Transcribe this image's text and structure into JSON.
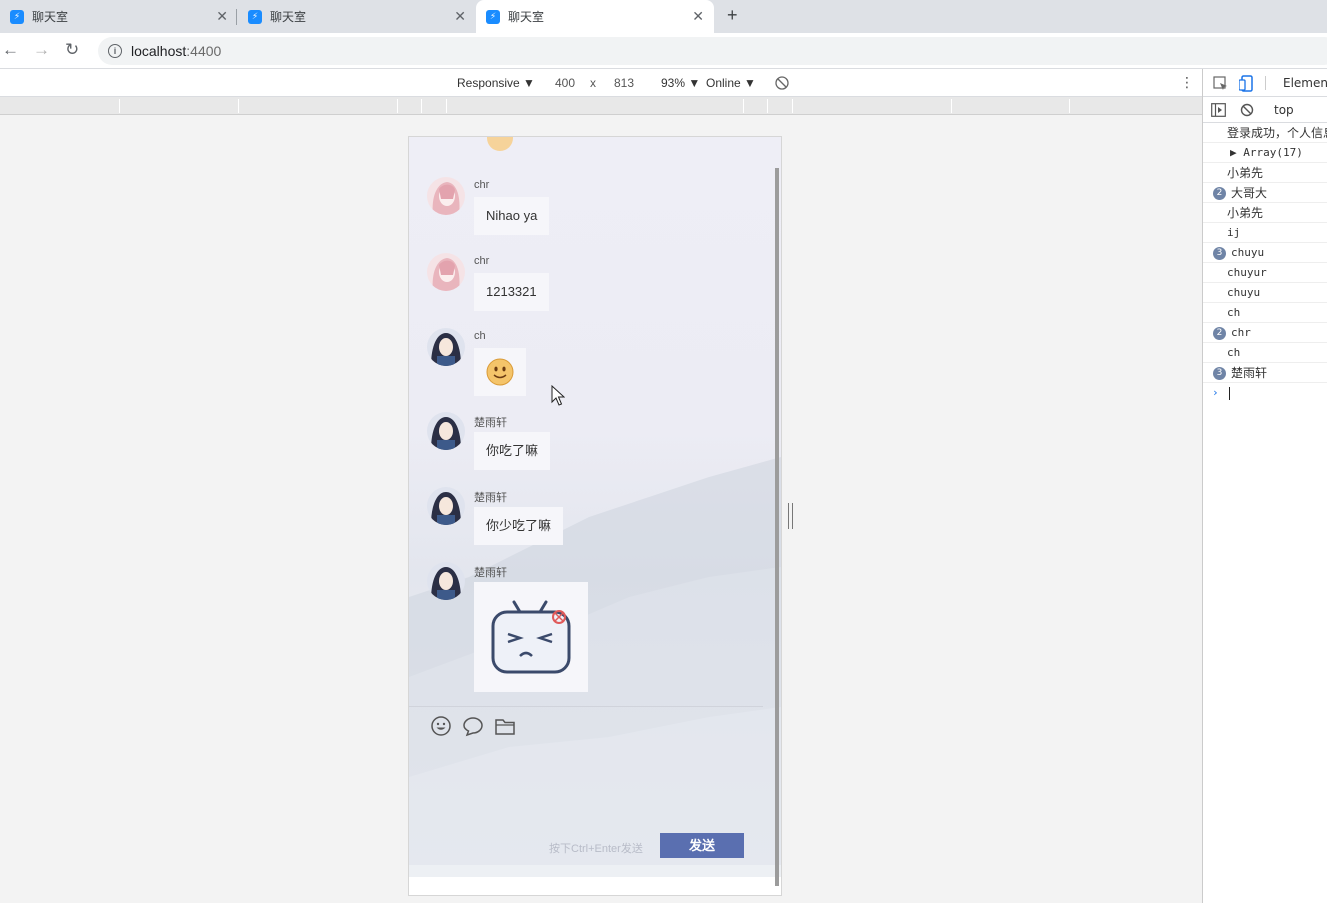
{
  "browser": {
    "tabs": [
      {
        "title": "聊天室",
        "active": false
      },
      {
        "title": "聊天室",
        "active": false
      },
      {
        "title": "聊天室",
        "active": true
      }
    ],
    "url_host": "localhost",
    "url_port": ":4400"
  },
  "device_toolbar": {
    "device": "Responsive ▼",
    "width": "400",
    "times": "x",
    "height": "813",
    "zoom": "93% ▼",
    "network": "Online ▼"
  },
  "chat": {
    "messages": [
      {
        "user": "chr",
        "text": "Nihao ya",
        "type": "text",
        "avatar": "pink-hair-girl"
      },
      {
        "user": "chr",
        "text": "1213321",
        "type": "text",
        "avatar": "pink-hair-girl"
      },
      {
        "user": "ch",
        "text": "",
        "type": "emoji",
        "avatar": "dark-hair-girl"
      },
      {
        "user": "楚雨轩",
        "text": "你吃了嘛",
        "type": "text",
        "avatar": "dark-hair-girl"
      },
      {
        "user": "楚雨轩",
        "text": "你少吃了嘛",
        "type": "text",
        "avatar": "dark-hair-girl"
      },
      {
        "user": "楚雨轩",
        "text": "",
        "type": "sticker",
        "avatar": "dark-hair-girl"
      }
    ],
    "input_hint": "按下Ctrl+Enter发送",
    "send_label": "发送",
    "colors": {
      "send_button": "#5a6fb0",
      "bubble": "#f6f6fa"
    }
  },
  "devtools": {
    "tab_label": "Element",
    "context": "top",
    "console": [
      {
        "text": "登录成功，个人信息",
        "count": null
      },
      {
        "text": "▶ Array(17)",
        "count": null
      },
      {
        "text": "小弟先",
        "count": null
      },
      {
        "text": "大哥大",
        "count": "2"
      },
      {
        "text": "小弟先",
        "count": null
      },
      {
        "text": "ij",
        "count": null
      },
      {
        "text": "chuyu",
        "count": "3"
      },
      {
        "text": "chuyur",
        "count": null
      },
      {
        "text": "chuyu",
        "count": null
      },
      {
        "text": "ch",
        "count": null
      },
      {
        "text": "chr",
        "count": "2"
      },
      {
        "text": "ch",
        "count": null
      },
      {
        "text": "楚雨轩",
        "count": "3"
      }
    ],
    "prompt": "›"
  }
}
